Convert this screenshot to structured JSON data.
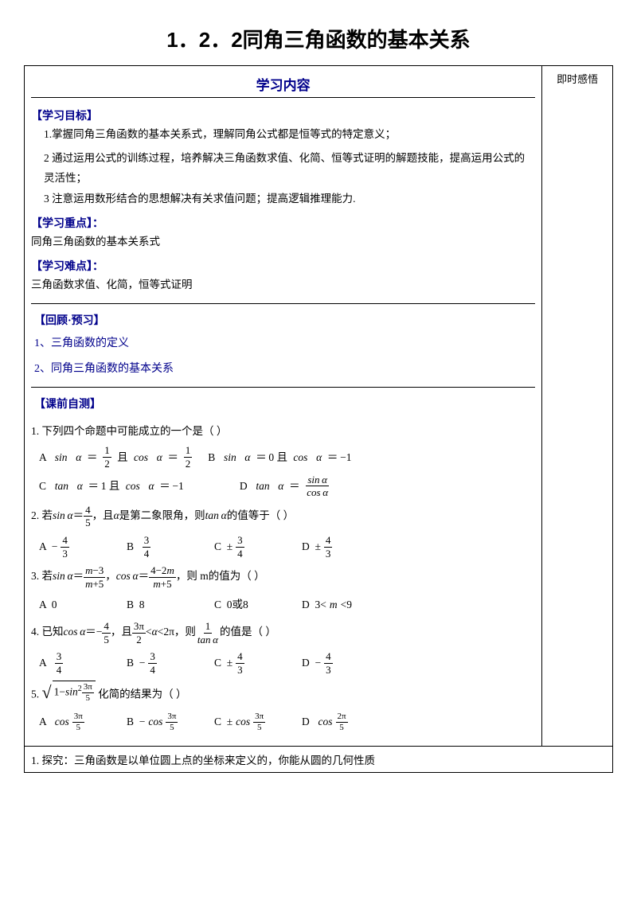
{
  "page": {
    "title": "1．2．2同角三角函数的基本关系",
    "header_left": "学习内容",
    "header_right": "即时感悟",
    "learning_obj_header": "【学习目标】",
    "learning_obj_1": "1.掌握同角三角函数的基本关系式，理解同角公式都是恒等式的特定意义；",
    "learning_obj_2": "2 通过运用公式的训练过程，培养解决三角函数求值、化简、恒等式证明的解题技能，提高运用公式的灵活性；",
    "learning_obj_3": "3 注意运用数形结合的思想解决有关求值问题；提高逻辑推理能力.",
    "key_points_header": "【学习重点】：",
    "key_points_text": "同角三角函数的基本关系式",
    "difficulties_header": "【学习难点】：",
    "difficulties_text": "三角函数求值、化简，恒等式证明",
    "review_header": "【回顾·预习】",
    "review_1": "1、三角函数的定义",
    "review_2": "2、同角三角函数的基本关系",
    "pretest_header": "【课前自测】",
    "q1_text": "1. 下列四个命题中可能成立的一个是（    ）",
    "q2_text": "2. 若sinα＝",
    "q2_suffix": "，且α是第二象限角，则tanα的值等于（    ）",
    "q3_text": "3. 若sinα＝",
    "q3_mid": "，cosα＝",
    "q3_suffix": "，则 m的值为（    ）",
    "q4_text": "4. 已知cosα＝",
    "q4_mid": "，且",
    "q4_suffix": "的值是（    ）",
    "q5_text": "5.",
    "q5_suffix": "化简的结果为（    ）",
    "explore_text": "1.  探究：三角函数是以单位圆上点的坐标来定义的，你能从圆的几何性质"
  }
}
